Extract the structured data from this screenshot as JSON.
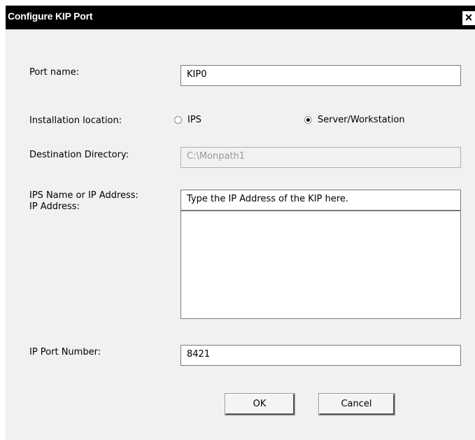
{
  "window": {
    "title": "Configure KIP Port",
    "close_symbol": "×"
  },
  "form": {
    "port_name": {
      "label": "Port name:",
      "value": "KIP0"
    },
    "installation_location": {
      "label": "Installation location:",
      "options": [
        {
          "label": "IPS",
          "selected": false
        },
        {
          "label": "Server/Workstation",
          "selected": true
        }
      ]
    },
    "destination_directory": {
      "label": "Destination Directory:",
      "value": "C:\\Monpath1"
    },
    "ips_name": {
      "label_line1": "IPS Name or IP Address:",
      "label_line2": "IP Address:",
      "value": "Type the IP Address of the KIP here."
    },
    "ip_port_number": {
      "label": "IP Port Number:",
      "value": "8421"
    }
  },
  "buttons": {
    "ok": "OK",
    "cancel": "Cancel"
  }
}
